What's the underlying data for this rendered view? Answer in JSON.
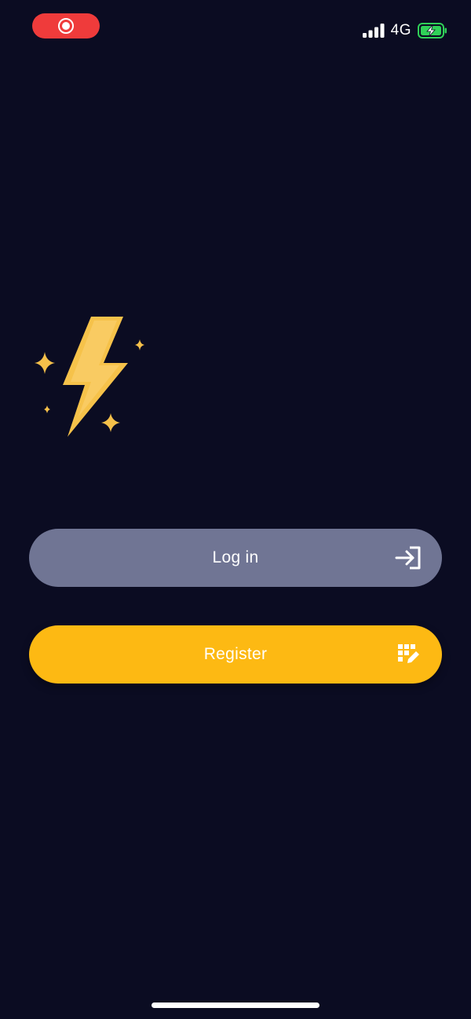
{
  "status_bar": {
    "network": "4G",
    "recording_color": "#ef3b3b",
    "battery_color": "#30d158"
  },
  "logo": {
    "icon": "lightning-bolt-with-sparkles",
    "bolt_color": "#f6c24a",
    "sparkle_color": "#f5c04a"
  },
  "actions": {
    "login_label": "Log in",
    "login_icon": "login-arrow-icon",
    "login_color": "#707594",
    "register_label": "Register",
    "register_icon": "register-form-icon",
    "register_color": "#fdb913"
  },
  "theme": {
    "background": "#0b0c22"
  }
}
